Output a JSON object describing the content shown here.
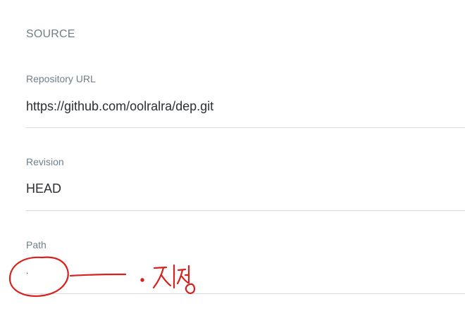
{
  "section": {
    "title": "SOURCE"
  },
  "fields": {
    "repository_url": {
      "label": "Repository URL",
      "value": "https://github.com/oolralra/dep.git"
    },
    "revision": {
      "label": "Revision",
      "value": "HEAD"
    },
    "path": {
      "label": "Path",
      "value": "."
    }
  },
  "annotation": {
    "handwritten_note": "· 지정",
    "color": "#d8201c"
  },
  "colors": {
    "label": "#6d7f8b",
    "value": "#2b2f33",
    "underline": "#d6dde2"
  }
}
